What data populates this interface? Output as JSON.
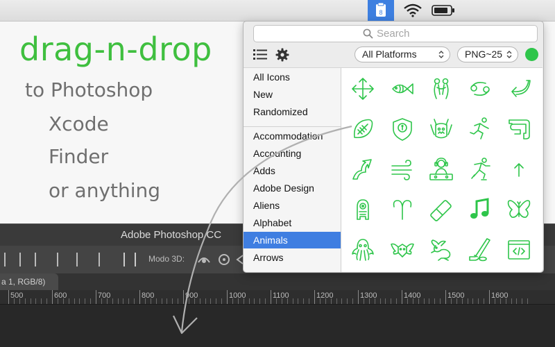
{
  "menubar": {
    "app_badge": "8",
    "items": [
      "app-icon",
      "wifi-icon",
      "battery-icon"
    ]
  },
  "promo": {
    "headline": "drag-n-drop",
    "lines": [
      "to Photoshop",
      "Xcode",
      "Finder",
      "or anything"
    ]
  },
  "photoshop": {
    "title": "Adobe Photoshop CC",
    "toolbar_label": "Modo 3D:",
    "doc_tab": "a 1, RGB/8)",
    "ruler": [
      "500",
      "600",
      "700",
      "800",
      "900",
      "1000",
      "1100",
      "1200",
      "1300",
      "1400",
      "1500",
      "1600"
    ]
  },
  "popover": {
    "search_placeholder": "Search",
    "platform": "All Platforms",
    "format": "PNG~25",
    "status_color": "#2ec54a",
    "icon_color": "#2ec54a",
    "sidebar_top": [
      "All Icons",
      "New",
      "Randomized"
    ],
    "sidebar_categories": [
      "Accommodation",
      "Accounting",
      "Adds",
      "Adobe Design",
      "Aliens",
      "Alphabet",
      "Animals",
      "Arrows"
    ],
    "selected_category": "Animals",
    "icons": [
      "move-arrows-icon",
      "fish-icon",
      "gemini-icon",
      "cancer-zodiac-icon",
      "return-arrow-icon",
      "american-football-icon",
      "keyhole-shield-icon",
      "monster-icon",
      "running-man-icon",
      "intestine-icon",
      "trending-up-arrow-icon",
      "wind-icon",
      "dj-icon",
      "ice-skating-icon",
      "up-arrow-icon",
      "alien-icon",
      "aries-icon",
      "eraser-icon",
      "music-note-icon",
      "butterfly-icon",
      "octopus-icon",
      "winged-emblem-icon",
      "rabbit-icon",
      "hockey-icon",
      "source-code-icon"
    ]
  }
}
